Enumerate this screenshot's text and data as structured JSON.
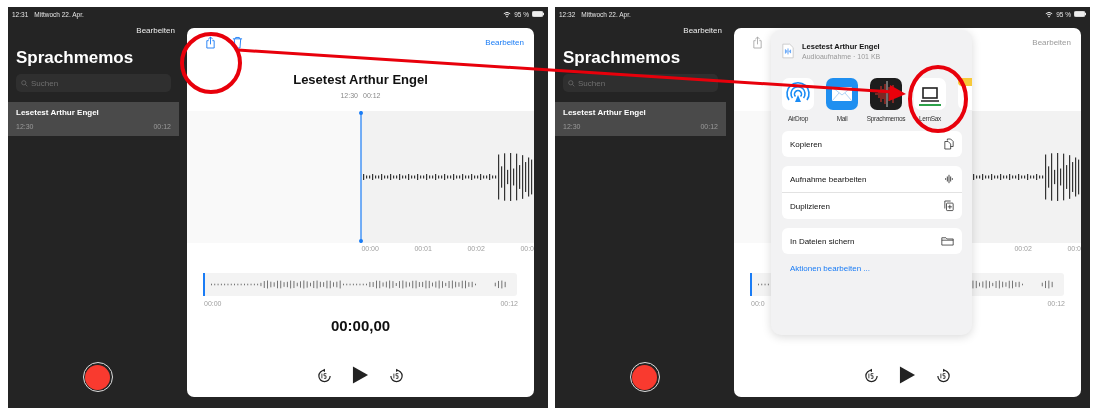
{
  "screens": [
    {
      "status_bar": {
        "time": "12:31",
        "date": "Mittwoch 22. Apr.",
        "battery": "95 %"
      },
      "sidebar": {
        "edit_label": "Bearbeiten",
        "title": "Sprachmemos",
        "search": {
          "placeholder": "Suchen"
        },
        "memos": [
          {
            "title": "Lesetest Arthur Engel",
            "time": "12:30",
            "duration": "00:12",
            "selected": true
          }
        ]
      },
      "detail": {
        "dimmed": false,
        "edit_label": "Bearbeiten",
        "title": "Lesetest Arthur Engel",
        "time": "12:30",
        "duration": "00:12",
        "ticks": [
          "00:00",
          "00:01",
          "00:02",
          "00:0"
        ],
        "scrubber_start": "00:00",
        "scrubber_end": "00:12",
        "timer": "00:00,00"
      }
    },
    {
      "status_bar": {
        "time": "12:32",
        "date": "Mittwoch 22. Apr.",
        "battery": "95 %"
      },
      "sidebar": {
        "edit_label": "Bearbeiten",
        "title": "Sprachmemos",
        "search": {
          "placeholder": "Suchen"
        },
        "memos": [
          {
            "title": "Lesetest Arthur Engel",
            "time": "12:30",
            "duration": "00:12",
            "selected": true
          }
        ]
      },
      "detail": {
        "dimmed": true,
        "edit_label": "Bearbeiten",
        "ticks": [
          "00:02",
          "00:0"
        ],
        "scrubber_start": "00:0",
        "scrubber_end": "00:12"
      },
      "share_sheet": {
        "title": "Lesetest Arthur Engel",
        "subtitle": "Audioaufnahme · 101 KB",
        "apps": [
          {
            "kind": "airdrop",
            "label": "AirDrop"
          },
          {
            "kind": "mail",
            "label": "Mail"
          },
          {
            "kind": "voice",
            "label": "Sprachmemos"
          },
          {
            "kind": "laptop",
            "label": "LernSax"
          },
          {
            "kind": "notes"
          }
        ],
        "action_groups": [
          [
            {
              "kind": "copy",
              "label": "Kopieren"
            }
          ],
          [
            {
              "kind": "wave",
              "label": "Aufnahme bearbeiten"
            },
            {
              "kind": "duplicate",
              "label": "Duplizieren"
            }
          ],
          [
            {
              "kind": "folder",
              "label": "In Dateien sichern"
            }
          ]
        ],
        "footer_link": "Aktionen bearbeiten ..."
      }
    }
  ]
}
